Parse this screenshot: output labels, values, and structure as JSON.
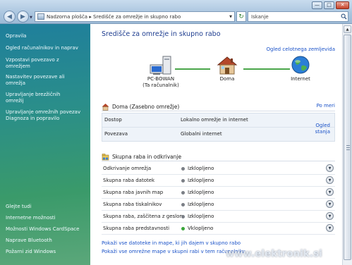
{
  "window": {
    "minimize_label": "—",
    "maximize_label": "□",
    "close_label": "✕"
  },
  "addressbar": {
    "path": "Nadzorna plošča ▸ Središče za omrežje in skupno rabo",
    "search_placeholder": "Iskanje"
  },
  "sidebar": {
    "tasks": [
      "Opravila",
      "Ogled računalnikov in naprav",
      "Vzpostavi povezavo z omrežjem",
      "Nastavitev povezave ali omrežja",
      "Upravljanje brezžičnih omrežij",
      "Upravljanje omrežnih povezav",
      "Diagnoza in popravilo"
    ],
    "see_also": [
      "Glejte tudi",
      "Internetne možnosti",
      "Možnosti Windows CardSpace",
      "Naprave Bluetooth",
      "Požarni zid Windows"
    ]
  },
  "main": {
    "title": "Središče za omrežje in skupno rabo",
    "map_link": "Ogled celotnega zemljevida",
    "nodes": [
      {
        "label": "PC-BOWAN",
        "sublabel": "(Ta računalnik)",
        "icon": "computer-icon"
      },
      {
        "label": "Doma",
        "sublabel": "",
        "icon": "house-icon"
      },
      {
        "label": "Internet",
        "sublabel": "",
        "icon": "globe-icon"
      }
    ],
    "network": {
      "title": "Doma (Zasebno omrežje)",
      "customize": "Po meri",
      "rows": [
        {
          "label": "Dostop",
          "value": "Lokalno omrežje in internet"
        },
        {
          "label": "Povezava",
          "value": "Globalni internet",
          "detail_line1": "Ogled",
          "detail_line2": "stanja"
        }
      ]
    },
    "sharing": {
      "title": "Skupna raba in odkrivanje",
      "rows": [
        {
          "label": "Odkrivanje omrežja",
          "state": "Izklopljeno",
          "on": false
        },
        {
          "label": "Skupna raba datotek",
          "state": "Izklopljeno",
          "on": false
        },
        {
          "label": "Skupna raba javnih map",
          "state": "Izklopljeno",
          "on": false
        },
        {
          "label": "Skupna raba tiskalnikov",
          "state": "Izklopljeno",
          "on": false
        },
        {
          "label": "Skupna raba, zaščitena z geslom",
          "state": "Izklopljeno",
          "on": false
        },
        {
          "label": "Skupna raba predstavnosti",
          "state": "Vklopljeno",
          "on": true
        }
      ]
    },
    "bottom_links": [
      "Pokaži vse datoteke in mape, ki jih dajem v skupno rabo",
      "Pokaži vse omrežne mape v skupni rabi v tem računalniku"
    ]
  },
  "watermark": "www.elektronik.si",
  "colors": {
    "on": "#3aa63a",
    "off": "#7b7f86",
    "link": "#1a52c8",
    "title": "#1e3d8f"
  }
}
